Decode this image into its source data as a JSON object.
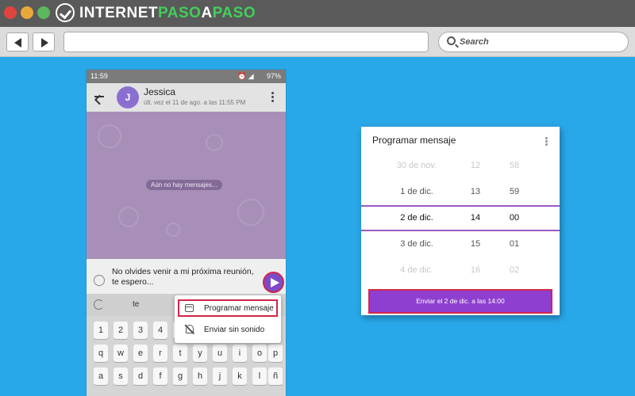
{
  "browser": {
    "logo": {
      "part1": "INTERNET",
      "part2": "PASO",
      "part3": "A",
      "part4": "PASO"
    },
    "search_label": "Search"
  },
  "phone": {
    "status": {
      "time": "11:59",
      "battery": "97%"
    },
    "header": {
      "avatar_initial": "J",
      "contact_name": "Jessica",
      "last_seen": "últ. vez el 11 de ago. a las 11:55 PM"
    },
    "empty_chat_label": "Aún no hay mensajes...",
    "message_text": "No olvides venir a mi próxima reunión, te espero...",
    "keyboard": {
      "suggestion": "te",
      "row1": [
        "1",
        "2",
        "3",
        "4",
        "5"
      ],
      "row2": [
        "q",
        "w",
        "e",
        "r",
        "t",
        "y",
        "u",
        "i",
        "o",
        "p"
      ],
      "row3": [
        "a",
        "s",
        "d",
        "f",
        "g",
        "h",
        "j",
        "k",
        "l",
        "ñ"
      ]
    },
    "popup": {
      "schedule_label": "Programar mensaje",
      "silent_label": "Enviar sin sonido"
    }
  },
  "dialog": {
    "title": "Programar mensaje",
    "rows": [
      {
        "date": "30 de nov.",
        "hour": "12",
        "minute": "58"
      },
      {
        "date": "1 de dic.",
        "hour": "13",
        "minute": "59"
      },
      {
        "date": "2 de dic.",
        "hour": "14",
        "minute": "00"
      },
      {
        "date": "3 de dic.",
        "hour": "15",
        "minute": "01"
      },
      {
        "date": "4 de dic.",
        "hour": "16",
        "minute": "02"
      }
    ],
    "selected_index": 2,
    "send_button": "Enviar el 2 de dic. a las 14:00"
  },
  "colors": {
    "background": "#29a8e9",
    "accent": "#8f3fd0",
    "highlight": "#d0264b",
    "chat_bg": "#a88fb8"
  }
}
